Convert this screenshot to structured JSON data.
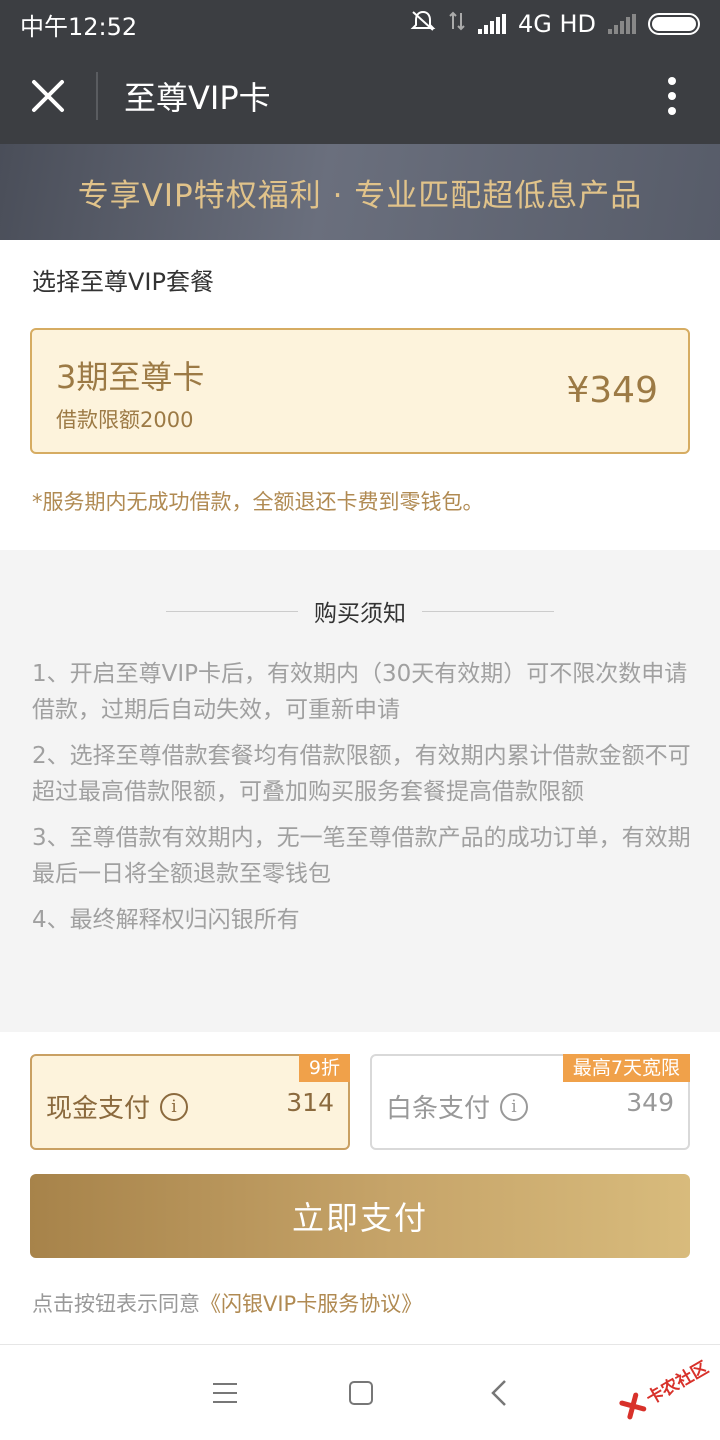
{
  "status_bar": {
    "time": "中午12:52",
    "network": "4G HD"
  },
  "nav": {
    "title": "至尊VIP卡"
  },
  "banner": {
    "text": "专享VIP特权福利 · 专业匹配超低息产品"
  },
  "plan_section": {
    "title": "选择至尊VIP套餐"
  },
  "plan": {
    "name": "3期至尊卡",
    "limit": "借款限额2000",
    "price": "¥349"
  },
  "refund_note": "*服务期内无成功借款，全额退还卡费到零钱包。",
  "notice": {
    "title": "购买须知",
    "items": [
      "1、开启至尊VIP卡后，有效期内（30天有效期）可不限次数申请借款，过期后自动失效，可重新申请",
      "2、选择至尊借款套餐均有借款限额，有效期内累计借款金额不可超过最高借款限额，可叠加购买服务套餐提高借款限额",
      "3、至尊借款有效期内，无一笔至尊借款产品的成功订单，有效期最后一日将全额退款至零钱包",
      "4、最终解释权归闪银所有"
    ]
  },
  "payment": {
    "cash": {
      "label": "现金支付",
      "amount": "314",
      "badge": "9折"
    },
    "credit": {
      "label": "白条支付",
      "amount": "349",
      "badge": "最高7天宽限"
    }
  },
  "pay_button": {
    "label": "立即支付"
  },
  "agreement": {
    "prefix": "点击按钮表示同意",
    "link": "《闪银VIP卡服务协议》"
  },
  "watermark": {
    "text": "卡农社区"
  },
  "colors": {
    "gold": "#9c7a45",
    "card_bg": "#fdf3dc",
    "badge": "#f0a14a",
    "nav_bg": "#3c3e42"
  }
}
